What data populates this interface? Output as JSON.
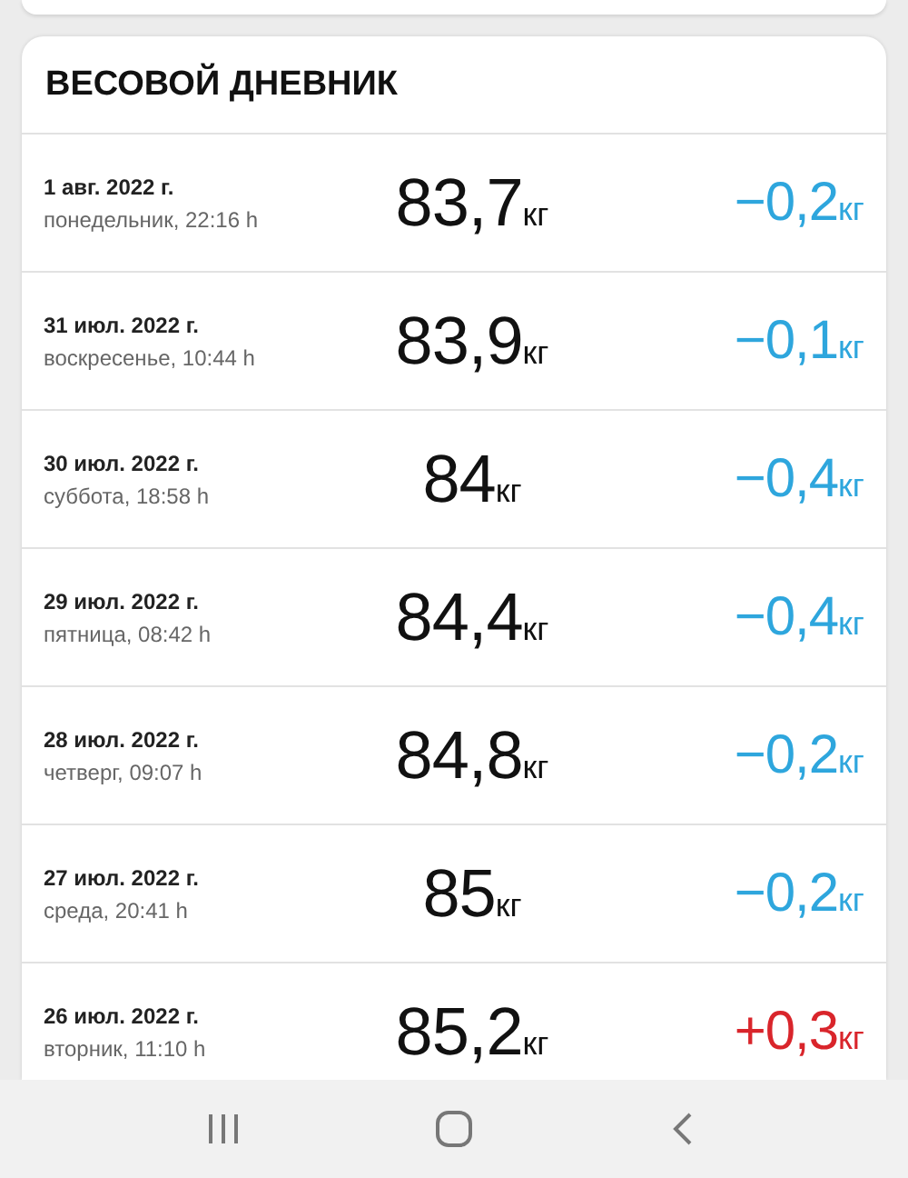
{
  "diary": {
    "title": "ВЕСОВОЙ ДНЕВНИК",
    "entries": [
      {
        "date": "1 авг. 2022 г.",
        "day_time": "понедельник, 22:16 h",
        "weight": "83,7",
        "weight_unit": "кг",
        "change": "−0,2",
        "change_unit": "кг",
        "color": "#2ea6dd"
      },
      {
        "date": "31 июл. 2022 г.",
        "day_time": "воскресенье, 10:44 h",
        "weight": "83,9",
        "weight_unit": "кг",
        "change": "−0,1",
        "change_unit": "кг",
        "color": "#2ea6dd"
      },
      {
        "date": "30 июл. 2022 г.",
        "day_time": "суббота, 18:58 h",
        "weight": "84",
        "weight_unit": "кг",
        "change": "−0,4",
        "change_unit": "кг",
        "color": "#2ea6dd"
      },
      {
        "date": "29 июл. 2022 г.",
        "day_time": "пятница, 08:42 h",
        "weight": "84,4",
        "weight_unit": "кг",
        "change": "−0,4",
        "change_unit": "кг",
        "color": "#2ea6dd"
      },
      {
        "date": "28 июл. 2022 г.",
        "day_time": "четверг, 09:07 h",
        "weight": "84,8",
        "weight_unit": "кг",
        "change": "−0,2",
        "change_unit": "кг",
        "color": "#2ea6dd"
      },
      {
        "date": "27 июл. 2022 г.",
        "day_time": "среда, 20:41 h",
        "weight": "85",
        "weight_unit": "кг",
        "change": "−0,2",
        "change_unit": "кг",
        "color": "#2ea6dd"
      },
      {
        "date": "26 июл. 2022 г.",
        "day_time": "вторник, 11:10 h",
        "weight": "85,2",
        "weight_unit": "кг",
        "change": "+0,3",
        "change_unit": "кг",
        "color": "#d9252b"
      }
    ]
  }
}
